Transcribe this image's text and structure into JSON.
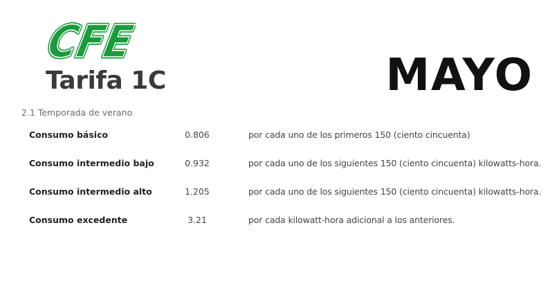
{
  "logo": {
    "text": "CFE",
    "color": "#1a9b3c"
  },
  "title": "Tarifa 1C",
  "month": "MAYO",
  "subtitle": "2.1 Temporada de verano",
  "rates": [
    {
      "name": "Consumo básico",
      "price": "0.806",
      "description": "por cada uno de los primeros 150 (ciento cincuenta)"
    },
    {
      "name": "Consumo intermedio bajo",
      "price": "0.932",
      "description": "por cada uno de los siguientes 150 (ciento cincuenta) kilowatts-hora."
    },
    {
      "name": "Consumo intermedio alto",
      "price": "1.205",
      "description": "por cada uno de los siguientes 150 (ciento cincuenta) kilowatts-hora."
    },
    {
      "name": "Consumo excedente",
      "price": "3.21",
      "description": "por cada kilowatt-hora adicional a los anteriores."
    }
  ]
}
